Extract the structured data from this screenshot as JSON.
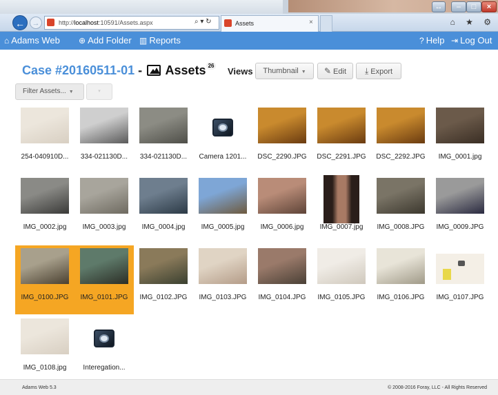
{
  "browser": {
    "address_prefix": "http://",
    "address_host": "localhost",
    "address_rest": ":10591/Assets.aspx",
    "address_tools": "⌕ ▾ ↻",
    "tab_title": "Assets",
    "tab_close": "×",
    "tools_icons": "⌂ ★ ⚙",
    "window_buttons": {
      "restore": "↔",
      "minimize": "–",
      "maximize": "□",
      "close": "×"
    }
  },
  "nav": {
    "home": "Adams Web",
    "add_folder": "Add Folder",
    "reports": "Reports",
    "help": "Help",
    "logout": "Log Out"
  },
  "header": {
    "case": "Case #20160511-01",
    "separator": "-",
    "assets_label": "Assets",
    "asset_count": "26",
    "views_label": "Views",
    "view_value": "Thumbnail",
    "edit_label": "Edit",
    "export_label": "Export"
  },
  "filter": {
    "label": "Filter Assets...",
    "second": "▾"
  },
  "colors": {
    "brand": "#4a8fd9",
    "selected": "#f5a623"
  },
  "assets": [
    {
      "label": "254-040910D...",
      "kind": "photo",
      "c1": "#ece6dc",
      "c2": "#d8cfc2",
      "selected": false
    },
    {
      "label": "334-021130D...",
      "kind": "photo",
      "c1": "#cfcfcf",
      "c2": "#5a5a5a",
      "selected": false
    },
    {
      "label": "334-021130D...",
      "kind": "photo",
      "c1": "#8c8c84",
      "c2": "#4e4e48",
      "selected": false
    },
    {
      "label": "Camera 1201...",
      "kind": "camera",
      "selected": false
    },
    {
      "label": "DSC_2290.JPG",
      "kind": "photo",
      "c1": "#c98a2e",
      "c2": "#6a3b10",
      "selected": false
    },
    {
      "label": "DSC_2291.JPG",
      "kind": "photo",
      "c1": "#c98a2e",
      "c2": "#6a3b10",
      "selected": false
    },
    {
      "label": "DSC_2292.JPG",
      "kind": "photo",
      "c1": "#c98a2e",
      "c2": "#6a3b10",
      "selected": false
    },
    {
      "label": "IMG_0001.jpg",
      "kind": "photo",
      "c1": "#6b5a4a",
      "c2": "#3a2e24",
      "selected": false
    },
    {
      "label": "IMG_0002.jpg",
      "kind": "photo",
      "c1": "#8a8a86",
      "c2": "#3a3a38",
      "selected": false
    },
    {
      "label": "IMG_0003.jpg",
      "kind": "photo",
      "c1": "#a8a59c",
      "c2": "#6e6a60",
      "selected": false
    },
    {
      "label": "IMG_0004.jpg",
      "kind": "photo",
      "c1": "#6e7e8e",
      "c2": "#2c3a46",
      "selected": false
    },
    {
      "label": "IMG_0005.jpg",
      "kind": "photo",
      "c1": "#7ea6d6",
      "c2": "#6e5a3e",
      "selected": false
    },
    {
      "label": "IMG_0006.jpg",
      "kind": "photo",
      "c1": "#b98c78",
      "c2": "#5e4438",
      "selected": false
    },
    {
      "label": "IMG_0007.jpg",
      "kind": "tall",
      "c1": "#2a1e1a",
      "c2": "#a87a64",
      "selected": false
    },
    {
      "label": "IMG_0008.JPG",
      "kind": "photo",
      "c1": "#7a7466",
      "c2": "#3c382e",
      "selected": false
    },
    {
      "label": "IMG_0009.JPG",
      "kind": "photo",
      "c1": "#9a9a9a",
      "c2": "#2a2a40",
      "selected": false
    },
    {
      "label": "IMG_0100.JPG",
      "kind": "photo",
      "c1": "#a8a08c",
      "c2": "#4a4030",
      "selected": true
    },
    {
      "label": "IMG_0101.JPG",
      "kind": "photo",
      "c1": "#5e7a6a",
      "c2": "#2c2e26",
      "selected": true
    },
    {
      "label": "IMG_0102.JPG",
      "kind": "photo",
      "c1": "#8a7a5a",
      "c2": "#3a4030",
      "selected": false
    },
    {
      "label": "IMG_0103.JPG",
      "kind": "photo",
      "c1": "#e0d4c4",
      "c2": "#b49c88",
      "selected": false
    },
    {
      "label": "IMG_0104.JPG",
      "kind": "photo",
      "c1": "#9a7a6a",
      "c2": "#4a4036",
      "selected": false
    },
    {
      "label": "IMG_0105.JPG",
      "kind": "photo",
      "c1": "#f0ece6",
      "c2": "#cfc8bc",
      "selected": false
    },
    {
      "label": "IMG_0106.JPG",
      "kind": "photo",
      "c1": "#e8e4d8",
      "c2": "#a09a88",
      "selected": false
    },
    {
      "label": "IMG_0107.JPG",
      "kind": "evidence",
      "c1": "#f4efe6",
      "c2": "#e8d84a",
      "selected": false
    },
    {
      "label": "IMG_0108.jpg",
      "kind": "photo",
      "c1": "#ece6dc",
      "c2": "#d8cfc2",
      "selected": false
    },
    {
      "label": "Interegation...",
      "kind": "camera",
      "selected": false
    }
  ],
  "footer": {
    "version": "Adams Web 5.3",
    "copyright": "© 2008-2016 Foray, LLC - All Rights Reserved"
  }
}
